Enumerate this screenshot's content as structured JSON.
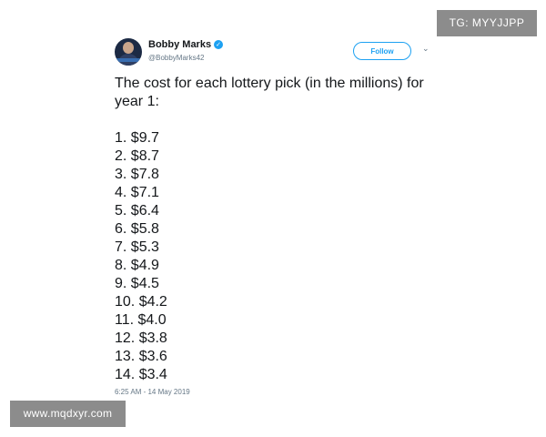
{
  "tweet": {
    "author": {
      "display_name": "Bobby Marks",
      "handle": "@BobbyMarks42",
      "verified": true,
      "verified_icon": "check-badge-icon"
    },
    "follow_label": "Follow",
    "menu_icon": "chevron-down-icon",
    "text": "The cost for each lottery pick (in the millions) for year 1:",
    "picks": [
      "1. $9.7",
      "2. $8.7",
      "3. $7.8",
      "4. $7.1",
      "5. $6.4",
      "6. $5.8",
      "7. $5.3",
      "8. $4.9",
      "9. $4.5",
      "10. $4.2",
      "11. $4.0",
      "12. $3.8",
      "13. $3.6",
      "14. $3.4"
    ],
    "timestamp": "6:25 AM - 14 May 2019"
  },
  "overlays": {
    "top_right": "TG: MYYJJPP",
    "bottom_left": "www.mqdxyr.com"
  },
  "colors": {
    "accent": "#1da1f2",
    "text": "#14171a",
    "muted": "#657786",
    "overlay_bg": "#8c8c8c"
  }
}
